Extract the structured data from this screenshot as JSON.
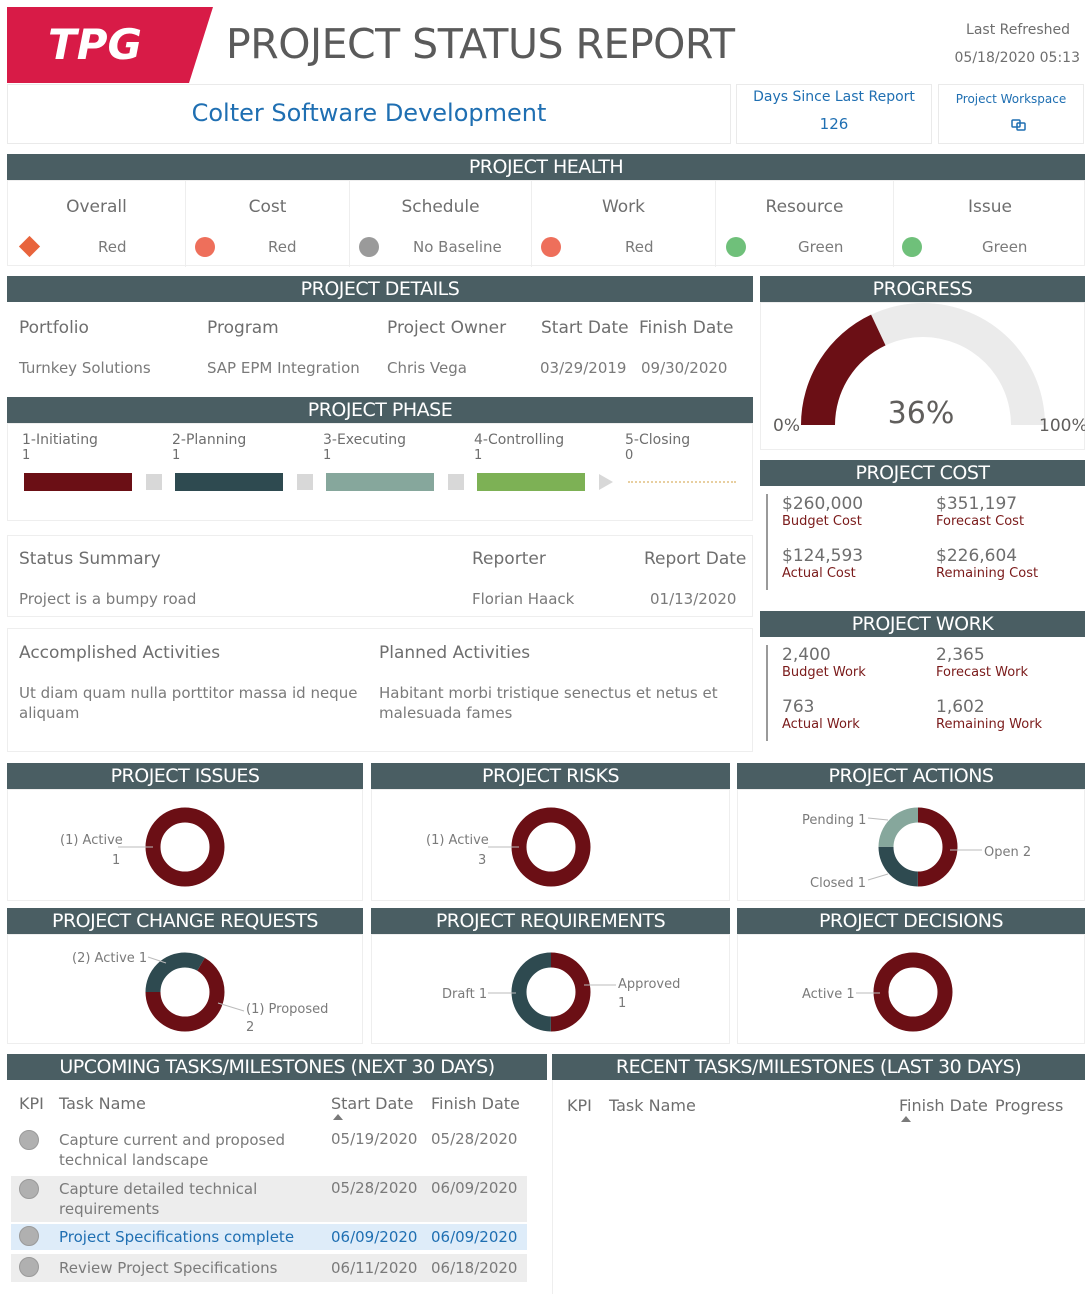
{
  "header": {
    "logo_text": "TPG",
    "title": "PROJECT STATUS REPORT",
    "last_refreshed_label": "Last Refreshed",
    "last_refreshed_value": "05/18/2020 05:13",
    "project_name": "Colter Software Development",
    "days_since_label": "Days Since Last Report",
    "days_since_value": "126",
    "workspace_label": "Project Workspace",
    "brand_color": "#d81b47"
  },
  "health": {
    "title": "PROJECT HEALTH",
    "items": [
      {
        "label": "Overall",
        "status": "Red",
        "icon": "diamond-icon",
        "color": "#e8643c"
      },
      {
        "label": "Cost",
        "status": "Red",
        "icon": "circle-icon",
        "color": "#ee6f5b"
      },
      {
        "label": "Schedule",
        "status": "No Baseline",
        "icon": "circle-icon",
        "color": "#9a9a9a"
      },
      {
        "label": "Work",
        "status": "Red",
        "icon": "circle-icon",
        "color": "#ee6f5b"
      },
      {
        "label": "Resource",
        "status": "Green",
        "icon": "circle-icon",
        "color": "#6fc07a"
      },
      {
        "label": "Issue",
        "status": "Green",
        "icon": "circle-icon",
        "color": "#6fc07a"
      }
    ]
  },
  "details": {
    "title": "PROJECT DETAILS",
    "headers": [
      "Portfolio",
      "Program",
      "Project Owner",
      "Start Date",
      "Finish Date"
    ],
    "values": [
      "Turnkey Solutions",
      "SAP EPM Integration",
      "Chris Vega",
      "03/29/2019",
      "09/30/2020"
    ]
  },
  "phase": {
    "title": "PROJECT PHASE",
    "items": [
      {
        "label": "1-Initiating",
        "count": "1",
        "color": "#6b0f15"
      },
      {
        "label": "2-Planning",
        "count": "1",
        "color": "#2e4a50"
      },
      {
        "label": "3-Executing",
        "count": "1",
        "color": "#86a79c"
      },
      {
        "label": "4-Controlling",
        "count": "1",
        "color": "#7db155"
      },
      {
        "label": "5-Closing",
        "count": "0",
        "color": "#e8cfa0"
      }
    ]
  },
  "status": {
    "headers": [
      "Status Summary",
      "Reporter",
      "Report Date"
    ],
    "values": [
      "Project is a bumpy road",
      "Florian Haack",
      "01/13/2020"
    ]
  },
  "activities": {
    "accomplished_label": "Accomplished Activities",
    "accomplished_text": "Ut diam quam nulla porttitor massa id neque aliquam",
    "planned_label": "Planned Activities",
    "planned_text": "Habitant morbi tristique senectus et netus et malesuada fames"
  },
  "progress": {
    "title": "PROGRESS",
    "value_label": "36%",
    "value": 0.36,
    "min_label": "0%",
    "max_label": "100%",
    "fill_color": "#6b0f15",
    "track_color": "#ebebeb"
  },
  "cost": {
    "title": "PROJECT COST",
    "items": [
      {
        "value": "$260,000",
        "label": "Budget Cost"
      },
      {
        "value": "$351,197",
        "label": "Forecast Cost"
      },
      {
        "value": "$124,593",
        "label": "Actual Cost"
      },
      {
        "value": "$226,604",
        "label": "Remaining Cost"
      }
    ]
  },
  "work": {
    "title": "PROJECT WORK",
    "items": [
      {
        "value": "2,400",
        "label": "Budget Work"
      },
      {
        "value": "2,365",
        "label": "Forecast Work"
      },
      {
        "value": "763",
        "label": "Actual Work"
      },
      {
        "value": "1,602",
        "label": "Remaining Work"
      }
    ]
  },
  "donuts": {
    "issues": {
      "title": "PROJECT ISSUES",
      "labels": [
        "(1) Active",
        "1"
      ]
    },
    "risks": {
      "title": "PROJECT RISKS",
      "labels": [
        "(1) Active",
        "3"
      ]
    },
    "actions": {
      "title": "PROJECT ACTIONS",
      "labels": [
        "Pending 1",
        "Open 2",
        "Closed 1"
      ]
    },
    "change_requests": {
      "title": "PROJECT CHANGE REQUESTS",
      "labels": [
        "(2) Active 1",
        "(1) Proposed",
        "2"
      ]
    },
    "requirements": {
      "title": "PROJECT REQUIREMENTS",
      "labels": [
        "Draft 1",
        "Approved",
        "1"
      ]
    },
    "decisions": {
      "title": "PROJECT DECISIONS",
      "labels": [
        "Active 1"
      ]
    }
  },
  "upcoming": {
    "title": "UPCOMING TASKS/MILESTONES (NEXT 30 DAYS)",
    "headers": [
      "KPI",
      "Task Name",
      "Start Date",
      "Finish Date"
    ],
    "rows": [
      {
        "name": "Capture current and proposed technical landscape",
        "start": "05/19/2020",
        "finish": "05/28/2020"
      },
      {
        "name": "Capture detailed technical requirements",
        "start": "05/28/2020",
        "finish": "06/09/2020"
      },
      {
        "name": "Project Specifications complete",
        "start": "06/09/2020",
        "finish": "06/09/2020"
      },
      {
        "name": "Review Project Specifications",
        "start": "06/11/2020",
        "finish": "06/18/2020"
      }
    ]
  },
  "recent": {
    "title": "RECENT TASKS/MILESTONES (LAST 30 DAYS)",
    "headers": [
      "KPI",
      "Task Name",
      "Finish Date",
      "Progress"
    ]
  }
}
